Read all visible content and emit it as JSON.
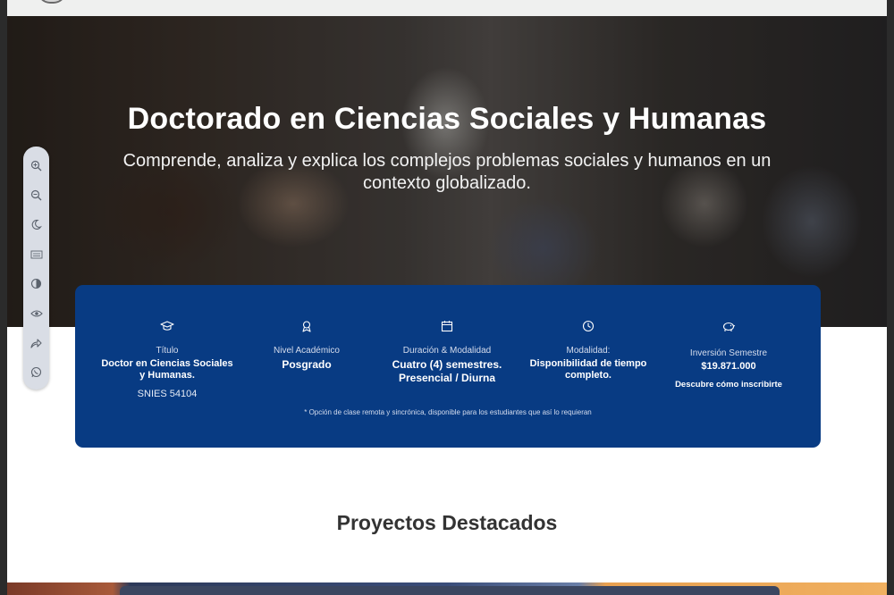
{
  "hero": {
    "title": "Doctorado en Ciencias Sociales y Humanas",
    "subtitle": "Comprende, analiza y explica los complejos problemas sociales y humanos en un contexto globalizado."
  },
  "accessibility_toolbar": {
    "tools": [
      "zoom-in-icon",
      "zoom-out-icon",
      "dark-mode-icon",
      "readable-font-icon",
      "contrast-icon",
      "eye-icon",
      "share-icon",
      "whatsapp-icon"
    ]
  },
  "info_card": {
    "titulo": {
      "label": "Título",
      "value": "Doctor en Ciencias Sociales y Humanas.",
      "snies": "SNIES 54104",
      "icon": "graduation-cap-icon"
    },
    "nivel": {
      "label": "Nivel Académico",
      "value": "Posgrado",
      "icon": "award-icon"
    },
    "duracion": {
      "label": "Duración & Modalidad",
      "value": "Cuatro (4) semestres. Presencial / Diurna",
      "icon": "calendar-icon"
    },
    "modalidad": {
      "label": "Modalidad:",
      "value": "Disponibilidad de  tiempo completo.",
      "icon": "clock-icon"
    },
    "inversion": {
      "label": "Inversión Semestre",
      "value": "$19.871.000",
      "link": "Descubre cómo inscribirte",
      "icon": "piggy-bank-icon"
    },
    "note": "* Opción de clase remota y sincrónica, disponible para los estudiantes que así lo requieran"
  },
  "projects": {
    "title": "Proyectos Destacados"
  },
  "colors": {
    "card_bg": "#083b83",
    "page_bg": "#ffffff",
    "topbar_bg": "#eff0ef"
  }
}
